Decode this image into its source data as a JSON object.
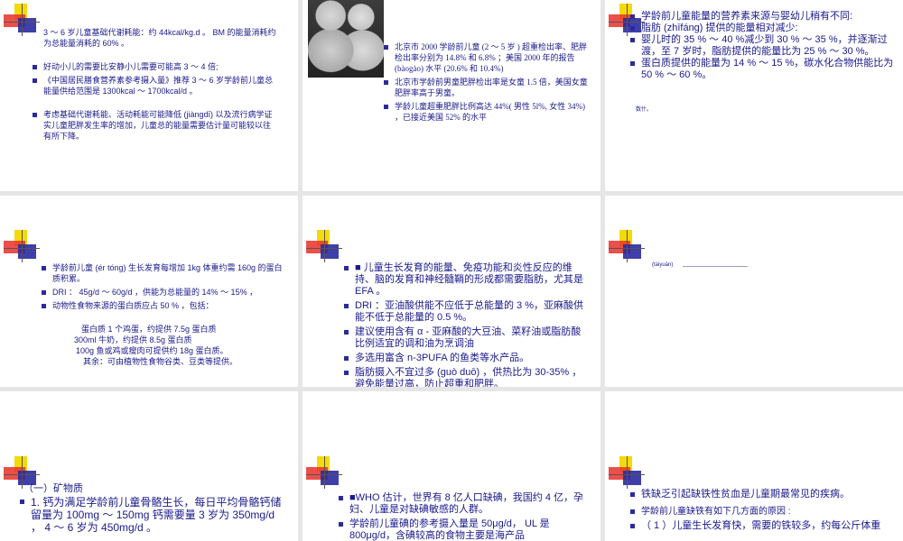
{
  "slide1": {
    "items": [
      "3 ～ 6 岁儿童基础代谢耗能：约 44kcal/kg.d 。 BM 的能量消耗约为总能量消耗的 60% 。",
      "好动小儿的需要比安静小儿需要可能高 3 ～ 4 倍;",
      "《中国居民膳食营养素参考摄入量》推荐 3 ～ 6 岁学龄前儿童总能量供给范围是 1300kcal ～ 1700kcal/d 。",
      "考虑基础代谢耗能、活动耗能可能降低 (jiàngdī) 以及流行病学证实儿童肥胖发生率的增加，儿童总的能量需要估计量可能较以往有所下降。"
    ]
  },
  "slide2": {
    "items": [
      "北京市 2000 学龄前儿童 (2 ～ 5 岁 ) 超重检出率、肥胖检出率分别为 14.8% 和 6.8% ；美国 2000 年的报告 (bàogào) 水平 (20.6% 和 10.4%)",
      "北京市学龄前男童肥胖检出率是女童 1.5 倍，美国女童肥胖率高于男童。",
      "学龄儿童超重肥胖比例高达 44%( 男性 5l%, 女性 34%) ，已接近美国 52% 的水平"
    ]
  },
  "slide3": {
    "intro": "学龄前儿童能量的营养素来源与婴幼儿稍有不同:",
    "items": [
      "脂肪 (zhīfáng) 提供的能量相对减少:",
      "婴儿时的 35 % ～ 40 %减少到 30 % ～ 35 %，并逐渐过渡，至 7 岁时，脂肪提供的能量比为 25 % ～ 30 %。",
      "蛋白质提供的能量为 14 % ～ 15 %，碳水化合物供能比为 50 % ～ 60 %。"
    ],
    "note": "数什。"
  },
  "slide4": {
    "items": [
      "学龄前儿童 (ér tóng) 生长发育每增加 1kg 体重约需 160g 的蛋白质积累。",
      "DRI ： 45g/d ～ 60g/d ，供能为总能量的 14% ～ 15% ，",
      "动物性食物来源的蛋白质应占 50 % ，包括："
    ],
    "foods": [
      "蛋白质 1 个鸡蛋，约提供 7.5g 蛋白质",
      "300ml 牛奶，约提供 8.5g 蛋白质",
      "100g 鱼或鸡或瘦肉可提供约 18g 蛋白质。",
      "其余：可由植物性食物谷类、豆类等提供。"
    ]
  },
  "slide5": {
    "items": [
      "■ 儿童生长发育的能量、免疫功能和炎性反应的维持、脑的发育和神经髓鞘的形成都需要脂肪，尤其是 EFA 。",
      "DRI ：亚油酸供能不应低于总能量的 3 %，亚麻酸供能不低于总能量的 0.5 %。",
      "建议使用含有 α - 亚麻酸的大豆油、菜籽油或脂肪酸比例适宜的调和油为烹调油",
      "多选用富含 n-3PUFA 的鱼类等水产品。",
      "脂肪摄入不宜过多 (guò duō) ，供热比为 30-35% ，避免能量过高，防止超重和肥胖。"
    ]
  },
  "slide6": {
    "line": "(tàiyuán)"
  },
  "slide7": {
    "heading": "（一）矿物质",
    "items": [
      "1. 钙为满足学龄前儿童骨骼生长，每日平均骨骼钙储留量为 100mg ～ 150mg 钙需要量 3 岁为 350mg/d ， 4 ～ 6 岁为 450mg/d 。"
    ]
  },
  "slide8": {
    "items": [
      "■WHO 估计，世界有 8 亿人口缺碘，我国约 4 亿，孕妇、儿童是对缺碘敏感的人群。",
      "学龄前儿童碘的参考摄入量是 50μg/d， UL 是 800μg/d，含碘较高的食物主要是海产品"
    ]
  },
  "slide9": {
    "items": [
      "铁缺乏引起缺铁性贫血是儿童期最常见的疾病。",
      "学龄前儿童缺铁有如下几方面的原因 :",
      "（ 1 ）儿童生长发育快，需要的铁较多，约每公斤体重"
    ]
  }
}
